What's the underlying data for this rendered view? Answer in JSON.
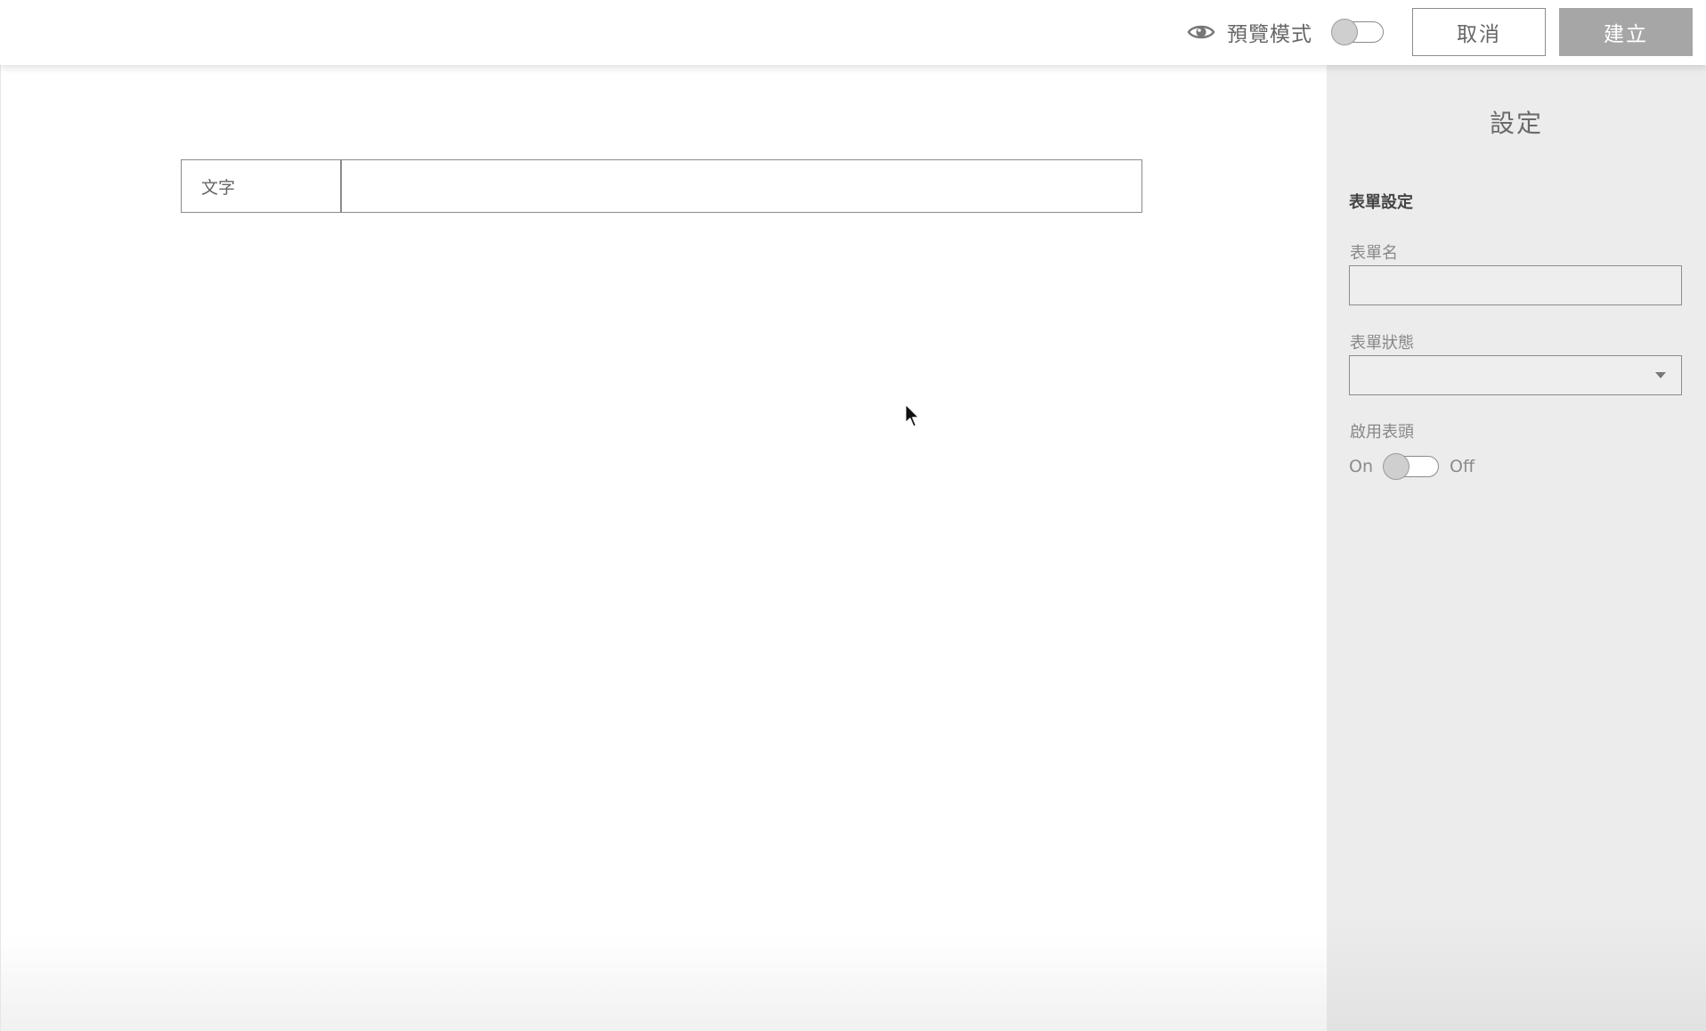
{
  "topbar": {
    "preview_icon": "eye-icon",
    "preview_label": "預覽模式",
    "preview_toggle_on": false,
    "cancel_label": "取消",
    "create_label": "建立"
  },
  "canvas": {
    "field": {
      "label": "文字",
      "value": ""
    }
  },
  "settings": {
    "title": "設定",
    "section_title": "表單設定",
    "form_name": {
      "label": "表單名",
      "value": ""
    },
    "form_status": {
      "label": "表單狀態",
      "value": "",
      "icon": "caret-down-icon"
    },
    "enable_header": {
      "label": "啟用表頭",
      "on_text": "On",
      "off_text": "Off",
      "value_on": false
    }
  },
  "colors": {
    "panel_bg": "#ececec",
    "create_button_bg": "#a6a6a6",
    "border": "#8a8a8a",
    "text": "#666666"
  }
}
